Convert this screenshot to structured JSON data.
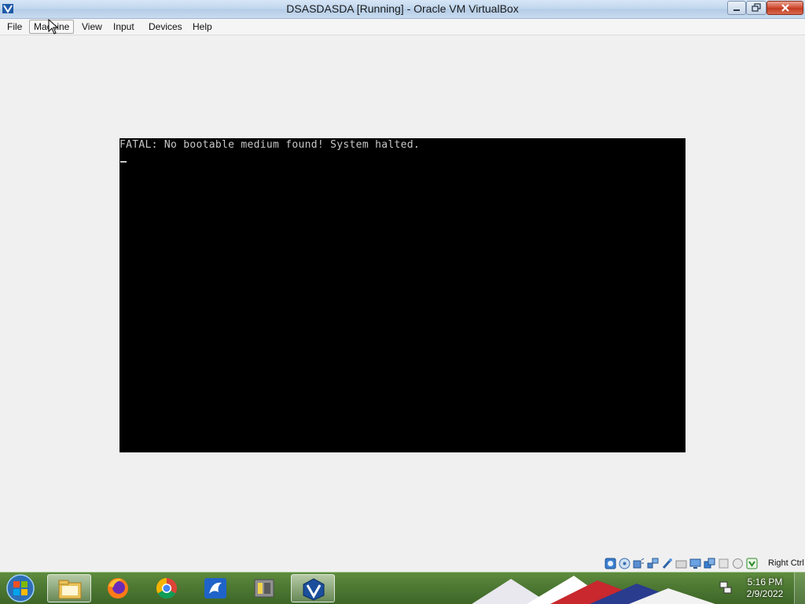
{
  "window": {
    "title": "DSASDASDA [Running] - Oracle VM VirtualBox",
    "app_icon": "virtualbox-icon",
    "controls": [
      "minimize-icon",
      "maximize-icon",
      "close-icon"
    ]
  },
  "menubar": {
    "items": [
      {
        "label": "File"
      },
      {
        "label": "Machine",
        "state": "hover"
      },
      {
        "label": "View"
      },
      {
        "label": "Input"
      },
      {
        "label": "Devices"
      },
      {
        "label": "Help"
      }
    ]
  },
  "vm_screen": {
    "message": "FATAL: No bootable medium found! System halted.",
    "background": "#000000",
    "text_color": "#c8c8c8"
  },
  "statusbar": {
    "icons": [
      "hard-disk-icon",
      "optical-drive-icon",
      "audio-icon",
      "network-icon",
      "usb-icon",
      "shared-folders-icon",
      "display-icon",
      "video-capture-icon",
      "mouse-integration-icon",
      "cpu-icon",
      "keyboard-capture-icon"
    ],
    "host_key": "Right Ctrl"
  },
  "taskbar": {
    "apps": [
      {
        "icon": "file-explorer-icon"
      },
      {
        "icon": "firefox-icon"
      },
      {
        "icon": "chrome-icon"
      },
      {
        "icon": "dolphin-app-icon"
      },
      {
        "icon": "archive-tool-icon"
      },
      {
        "icon": "virtualbox-icon",
        "active": true
      }
    ],
    "clock": {
      "time": "5:16 PM",
      "date": "2/9/2022"
    },
    "tray_icon": "network-tray-icon"
  },
  "colors": {
    "window_bg": "#f0f0f0",
    "titlebar": "#c3d8ee",
    "close_button": "#c94a2e",
    "taskbar": "#4f7a34"
  }
}
